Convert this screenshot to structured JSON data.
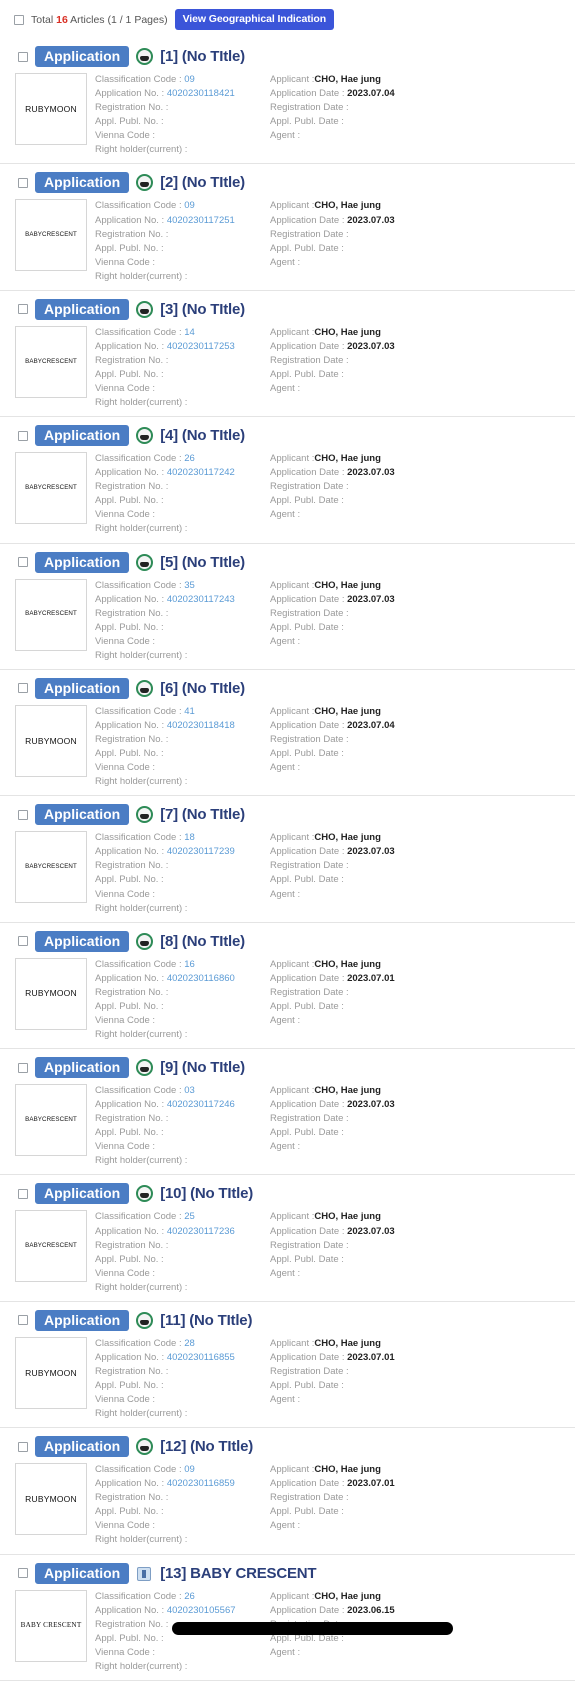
{
  "summary": {
    "text": "Total 16 Articles (1 / 1 Pages)",
    "count": "16",
    "prefix": "Total ",
    "suffix": " Articles (1 / 1 Pages)",
    "geo_button": "View Geographical Indication"
  },
  "labels": {
    "classification_code": "Classification Code :",
    "application_no": "Application No. :",
    "registration_no": "Registration No. :",
    "appl_publ_no": "Appl. Publ. No. :",
    "vienna_code": "Vienna Code :",
    "right_holder": "Right holder(current) :",
    "applicant": "Applicant :",
    "application_date": "Application Date :",
    "registration_date": "Registration Date :",
    "appl_publ_date": "Appl. Publ. Date :",
    "agent": "Agent :"
  },
  "results": [
    {
      "badge": "Application",
      "icon": "trademark-figure-icon",
      "title": "[1] (No TItle)",
      "thumb": "RUBYMOON",
      "thumb_style": "normal",
      "classification_code": "09",
      "application_no": "4020230118421",
      "registration_no": "",
      "appl_publ_no": "",
      "vienna_code": "",
      "right_holder": "",
      "applicant": "CHO, Hae jung",
      "application_date": "2023.07.04",
      "registration_date": "",
      "appl_publ_date": "",
      "agent": ""
    },
    {
      "badge": "Application",
      "icon": "trademark-figure-icon",
      "title": "[2] (No TItle)",
      "thumb": "BABYCRESCENT",
      "thumb_style": "small",
      "classification_code": "09",
      "application_no": "4020230117251",
      "registration_no": "",
      "appl_publ_no": "",
      "vienna_code": "",
      "right_holder": "",
      "applicant": "CHO, Hae jung",
      "application_date": "2023.07.03",
      "registration_date": "",
      "appl_publ_date": "",
      "agent": ""
    },
    {
      "badge": "Application",
      "icon": "trademark-figure-icon",
      "title": "[3] (No TItle)",
      "thumb": "BABYCRESCENT",
      "thumb_style": "small",
      "classification_code": "14",
      "application_no": "4020230117253",
      "registration_no": "",
      "appl_publ_no": "",
      "vienna_code": "",
      "right_holder": "",
      "applicant": "CHO, Hae jung",
      "application_date": "2023.07.03",
      "registration_date": "",
      "appl_publ_date": "",
      "agent": ""
    },
    {
      "badge": "Application",
      "icon": "trademark-figure-icon",
      "title": "[4] (No TItle)",
      "thumb": "BABYCRESCENT",
      "thumb_style": "small",
      "classification_code": "26",
      "application_no": "4020230117242",
      "registration_no": "",
      "appl_publ_no": "",
      "vienna_code": "",
      "right_holder": "",
      "applicant": "CHO, Hae jung",
      "application_date": "2023.07.03",
      "registration_date": "",
      "appl_publ_date": "",
      "agent": ""
    },
    {
      "badge": "Application",
      "icon": "trademark-figure-icon",
      "title": "[5] (No TItle)",
      "thumb": "BABYCRESCENT",
      "thumb_style": "small",
      "classification_code": "35",
      "application_no": "4020230117243",
      "registration_no": "",
      "appl_publ_no": "",
      "vienna_code": "",
      "right_holder": "",
      "applicant": "CHO, Hae jung",
      "application_date": "2023.07.03",
      "registration_date": "",
      "appl_publ_date": "",
      "agent": ""
    },
    {
      "badge": "Application",
      "icon": "trademark-figure-icon",
      "title": "[6] (No TItle)",
      "thumb": "RUBYMOON",
      "thumb_style": "normal",
      "classification_code": "41",
      "application_no": "4020230118418",
      "registration_no": "",
      "appl_publ_no": "",
      "vienna_code": "",
      "right_holder": "",
      "applicant": "CHO, Hae jung",
      "application_date": "2023.07.04",
      "registration_date": "",
      "appl_publ_date": "",
      "agent": ""
    },
    {
      "badge": "Application",
      "icon": "trademark-figure-icon",
      "title": "[7] (No TItle)",
      "thumb": "BABYCRESCENT",
      "thumb_style": "small",
      "classification_code": "18",
      "application_no": "4020230117239",
      "registration_no": "",
      "appl_publ_no": "",
      "vienna_code": "",
      "right_holder": "",
      "applicant": "CHO, Hae jung",
      "application_date": "2023.07.03",
      "registration_date": "",
      "appl_publ_date": "",
      "agent": ""
    },
    {
      "badge": "Application",
      "icon": "trademark-figure-icon",
      "title": "[8] (No TItle)",
      "thumb": "RUBYMOON",
      "thumb_style": "normal",
      "classification_code": "16",
      "application_no": "4020230116860",
      "registration_no": "",
      "appl_publ_no": "",
      "vienna_code": "",
      "right_holder": "",
      "applicant": "CHO, Hae jung",
      "application_date": "2023.07.01",
      "registration_date": "",
      "appl_publ_date": "",
      "agent": ""
    },
    {
      "badge": "Application",
      "icon": "trademark-figure-icon",
      "title": "[9] (No TItle)",
      "thumb": "BABYCRESCENT",
      "thumb_style": "small",
      "classification_code": "03",
      "application_no": "4020230117246",
      "registration_no": "",
      "appl_publ_no": "",
      "vienna_code": "",
      "right_holder": "",
      "applicant": "CHO, Hae jung",
      "application_date": "2023.07.03",
      "registration_date": "",
      "appl_publ_date": "",
      "agent": ""
    },
    {
      "badge": "Application",
      "icon": "trademark-figure-icon",
      "title": "[10] (No TItle)",
      "thumb": "BABYCRESCENT",
      "thumb_style": "small",
      "classification_code": "25",
      "application_no": "4020230117236",
      "registration_no": "",
      "appl_publ_no": "",
      "vienna_code": "",
      "right_holder": "",
      "applicant": "CHO, Hae jung",
      "application_date": "2023.07.03",
      "registration_date": "",
      "appl_publ_date": "",
      "agent": ""
    },
    {
      "badge": "Application",
      "icon": "trademark-figure-icon",
      "title": "[11] (No TItle)",
      "thumb": "RUBYMOON",
      "thumb_style": "normal",
      "classification_code": "28",
      "application_no": "4020230116855",
      "registration_no": "",
      "appl_publ_no": "",
      "vienna_code": "",
      "right_holder": "",
      "applicant": "CHO, Hae jung",
      "application_date": "2023.07.01",
      "registration_date": "",
      "appl_publ_date": "",
      "agent": ""
    },
    {
      "badge": "Application",
      "icon": "trademark-figure-icon",
      "title": "[12] (No TItle)",
      "thumb": "RUBYMOON",
      "thumb_style": "normal",
      "classification_code": "09",
      "application_no": "4020230116859",
      "registration_no": "",
      "appl_publ_no": "",
      "vienna_code": "",
      "right_holder": "",
      "applicant": "CHO, Hae jung",
      "application_date": "2023.07.01",
      "registration_date": "",
      "appl_publ_date": "",
      "agent": ""
    },
    {
      "badge": "Application",
      "icon": "trademark-text-icon",
      "title": "[13] BABY CRESCENT",
      "thumb": "BABY CRESCENT",
      "thumb_style": "serif",
      "classification_code": "26",
      "application_no": "4020230105567",
      "registration_no": "",
      "appl_publ_no": "",
      "vienna_code": "",
      "right_holder": "",
      "applicant": "CHO, Hae jung",
      "application_date": "2023.06.15",
      "registration_date": "",
      "appl_publ_date": "",
      "agent": ""
    }
  ]
}
